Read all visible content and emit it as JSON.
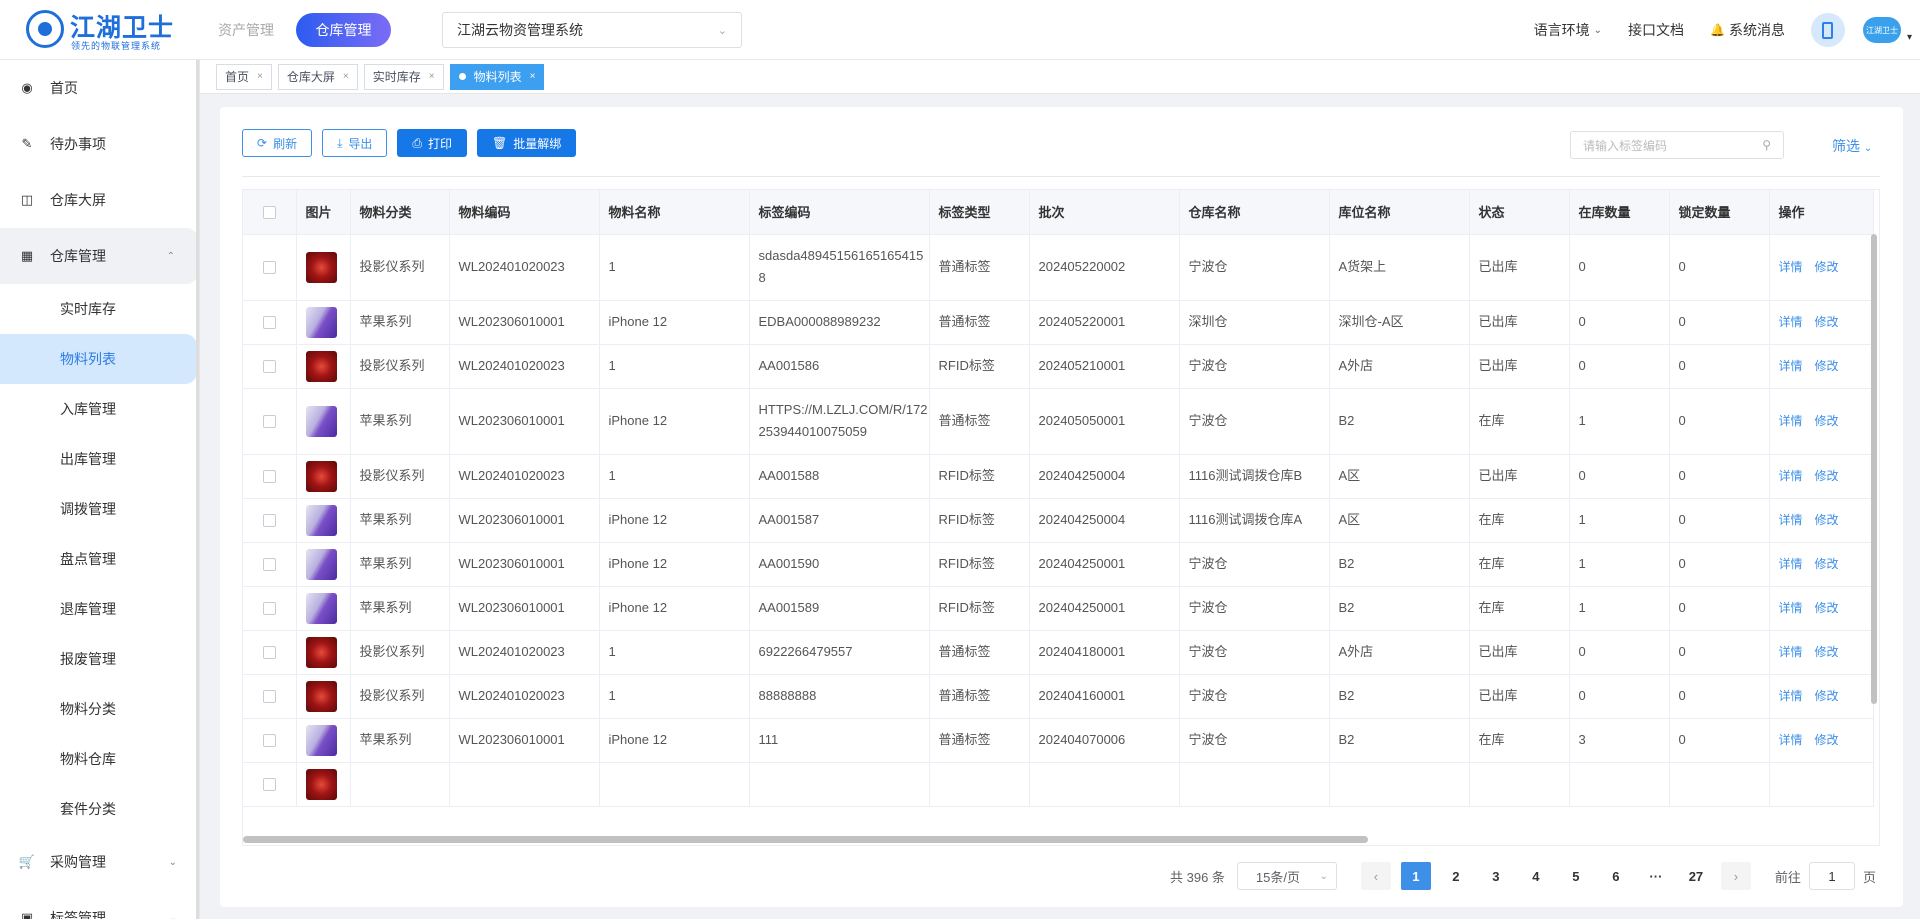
{
  "header": {
    "logo_text": "江湖卫士",
    "logo_sub": "领先的物联管理系统",
    "nav_asset": "资产管理",
    "nav_warehouse": "仓库管理",
    "system_select": "江湖云物资管理系统",
    "language": "语言环境",
    "api_docs": "接口文档",
    "messages": "系统消息",
    "avatar_text": "江湖卫士"
  },
  "sidebar": {
    "home": "首页",
    "todo": "待办事项",
    "screen": "仓库大屏",
    "warehouse": "仓库管理",
    "sub": [
      "实时库存",
      "物料列表",
      "入库管理",
      "出库管理",
      "调拨管理",
      "盘点管理",
      "退库管理",
      "报废管理",
      "物料分类",
      "物料仓库",
      "套件分类"
    ],
    "purchase": "采购管理",
    "label": "标签管理"
  },
  "tabs": [
    "首页",
    "仓库大屏",
    "实时库存",
    "物料列表"
  ],
  "toolbar": {
    "refresh": "刷新",
    "export": "导出",
    "print": "打印",
    "unbind": "批量解绑",
    "search_placeholder": "请输入标签编码",
    "filter": "筛选"
  },
  "table": {
    "headers": [
      "图片",
      "物料分类",
      "物料编码",
      "物料名称",
      "标签编码",
      "标签类型",
      "批次",
      "仓库名称",
      "库位名称",
      "状态",
      "在库数量",
      "锁定数量",
      "操作"
    ],
    "detail": "详情",
    "edit": "修改",
    "rows": [
      {
        "img": "proj",
        "cat": "投影仪系列",
        "code": "WL202401020023",
        "name": "1",
        "tag": "sdasda489451561651654158",
        "type": "普通标签",
        "batch": "202405220002",
        "wh": "宁波仓",
        "loc": "A货架上",
        "status": "已出库",
        "qty": "0",
        "lock": "0"
      },
      {
        "img": "apple",
        "cat": "苹果系列",
        "code": "WL202306010001",
        "name": "iPhone 12",
        "tag": "EDBA000088989232",
        "type": "普通标签",
        "batch": "202405220001",
        "wh": "深圳仓",
        "loc": "深圳仓-A区",
        "status": "已出库",
        "qty": "0",
        "lock": "0"
      },
      {
        "img": "proj",
        "cat": "投影仪系列",
        "code": "WL202401020023",
        "name": "1",
        "tag": "AA001586",
        "type": "RFID标签",
        "batch": "202405210001",
        "wh": "宁波仓",
        "loc": "A外店",
        "status": "已出库",
        "qty": "0",
        "lock": "0"
      },
      {
        "img": "apple",
        "cat": "苹果系列",
        "code": "WL202306010001",
        "name": "iPhone 12",
        "tag": "HTTPS://M.LZLJ.COM/R/172253944010075059",
        "type": "普通标签",
        "batch": "202405050001",
        "wh": "宁波仓",
        "loc": "B2",
        "status": "在库",
        "qty": "1",
        "lock": "0"
      },
      {
        "img": "proj",
        "cat": "投影仪系列",
        "code": "WL202401020023",
        "name": "1",
        "tag": "AA001588",
        "type": "RFID标签",
        "batch": "202404250004",
        "wh": "1116测试调拨仓库B",
        "loc": "A区",
        "status": "已出库",
        "qty": "0",
        "lock": "0"
      },
      {
        "img": "apple",
        "cat": "苹果系列",
        "code": "WL202306010001",
        "name": "iPhone 12",
        "tag": "AA001587",
        "type": "RFID标签",
        "batch": "202404250004",
        "wh": "1116测试调拨仓库A",
        "loc": "A区",
        "status": "在库",
        "qty": "1",
        "lock": "0"
      },
      {
        "img": "apple",
        "cat": "苹果系列",
        "code": "WL202306010001",
        "name": "iPhone 12",
        "tag": "AA001590",
        "type": "RFID标签",
        "batch": "202404250001",
        "wh": "宁波仓",
        "loc": "B2",
        "status": "在库",
        "qty": "1",
        "lock": "0"
      },
      {
        "img": "apple",
        "cat": "苹果系列",
        "code": "WL202306010001",
        "name": "iPhone 12",
        "tag": "AA001589",
        "type": "RFID标签",
        "batch": "202404250001",
        "wh": "宁波仓",
        "loc": "B2",
        "status": "在库",
        "qty": "1",
        "lock": "0"
      },
      {
        "img": "proj",
        "cat": "投影仪系列",
        "code": "WL202401020023",
        "name": "1",
        "tag": "6922266479557",
        "type": "普通标签",
        "batch": "202404180001",
        "wh": "宁波仓",
        "loc": "A外店",
        "status": "已出库",
        "qty": "0",
        "lock": "0"
      },
      {
        "img": "proj",
        "cat": "投影仪系列",
        "code": "WL202401020023",
        "name": "1",
        "tag": "88888888",
        "type": "普通标签",
        "batch": "202404160001",
        "wh": "宁波仓",
        "loc": "B2",
        "status": "已出库",
        "qty": "0",
        "lock": "0"
      },
      {
        "img": "apple",
        "cat": "苹果系列",
        "code": "WL202306010001",
        "name": "iPhone 12",
        "tag": "111",
        "type": "普通标签",
        "batch": "202404070006",
        "wh": "宁波仓",
        "loc": "B2",
        "status": "在库",
        "qty": "3",
        "lock": "0"
      },
      {
        "img": "proj",
        "cat": "",
        "code": "",
        "name": "",
        "tag": "",
        "type": "",
        "batch": "",
        "wh": "",
        "loc": "",
        "status": "",
        "qty": "",
        "lock": ""
      }
    ]
  },
  "pagination": {
    "total": "共 396 条",
    "page_size": "15条/页",
    "pages": [
      "1",
      "2",
      "3",
      "4",
      "5",
      "6",
      "···",
      "27"
    ],
    "goto_label": "前往",
    "goto_value": "1",
    "goto_unit": "页"
  }
}
